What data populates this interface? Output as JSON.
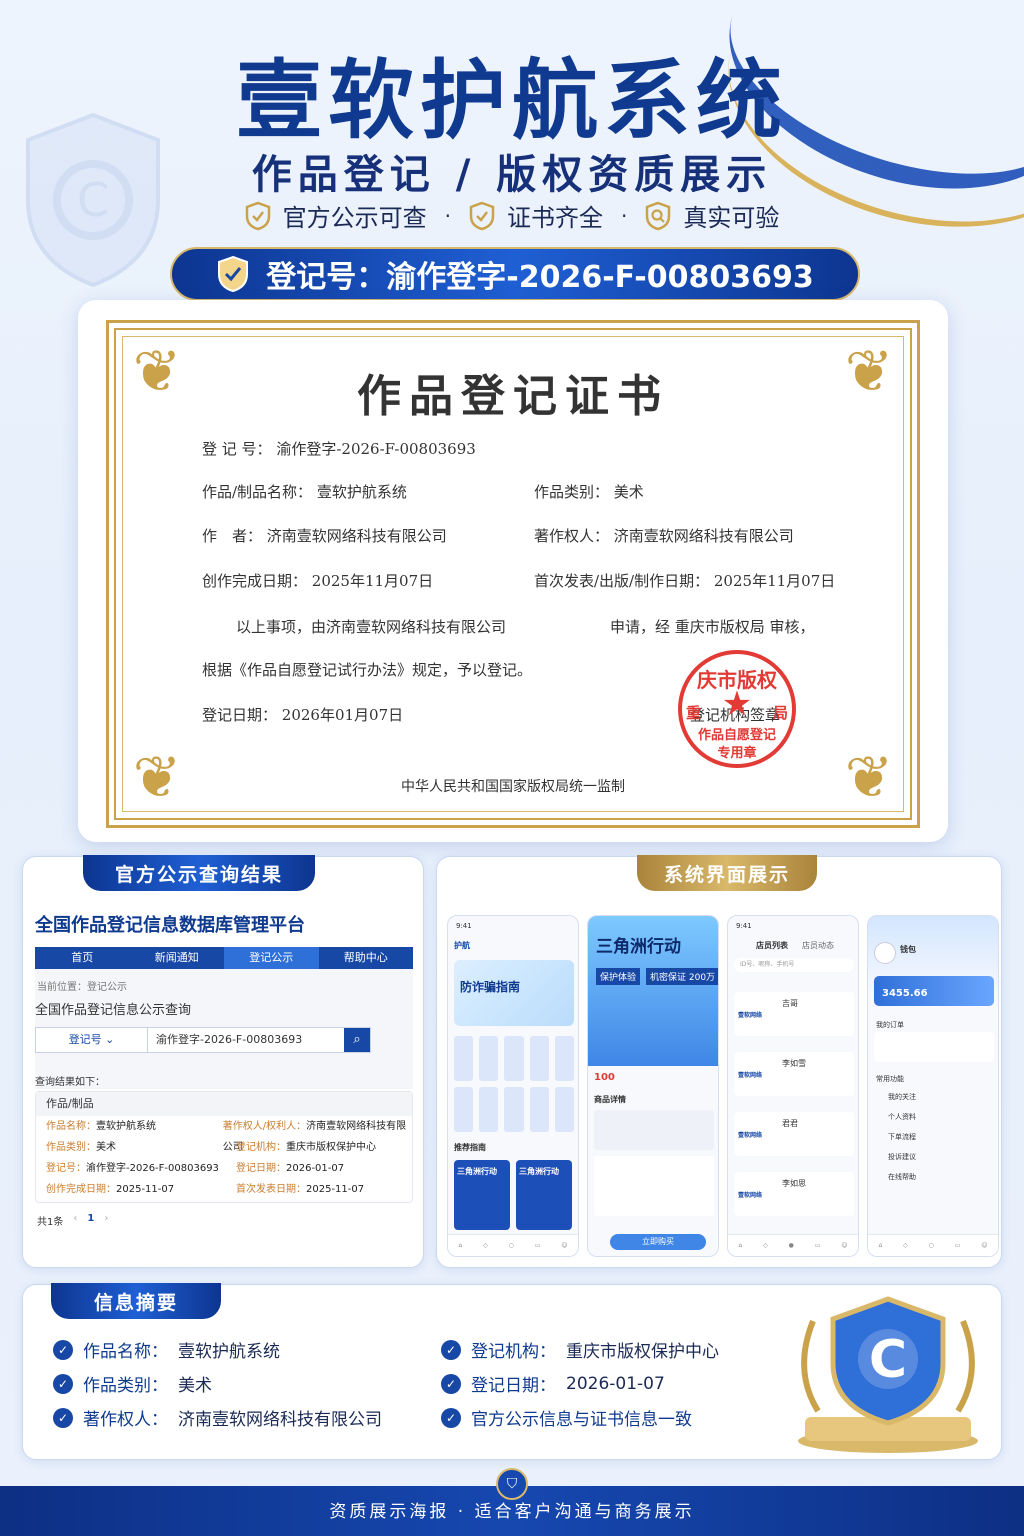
{
  "header": {
    "title": "壹软护航系统",
    "subtitle": "作品登记 / 版权资质展示",
    "badges": [
      "官方公示可查",
      "证书齐全",
      "真实可验"
    ],
    "reg_label": "登记号：渝作登字-2026-F-00803693"
  },
  "certificate": {
    "title": "作品登记证书",
    "reg_no_label": "登 记 号：",
    "reg_no": "渝作登字-2026-F-00803693",
    "work_name_label": "作品/制品名称：",
    "work_name": "壹软护航系统",
    "category_label": "作品类别：",
    "category": "美术",
    "author_label": "作　者：",
    "author": "济南壹软网络科技有限公司",
    "owner_label": "著作权人：",
    "owner": "济南壹软网络科技有限公司",
    "complete_label": "创作完成日期：",
    "complete_date": "2025年11月07日",
    "publish_label": "首次发表/出版/制作日期：",
    "publish_date": "2025年11月07日",
    "statement_1a": "以上事项，由济南壹软网络科技有限公司",
    "statement_1b": "申请，经 重庆市版权局 审核，",
    "statement_2": "根据《作品自愿登记试行办法》规定，予以登记。",
    "reg_date_label": "登记日期：",
    "reg_date": "2026年01月07日",
    "seal_under_text": "登记机构签章",
    "supervision": "中华人民共和国国家版权局统一监制",
    "seal": {
      "top": "庆市版权",
      "left": "重",
      "right": "局",
      "line1": "作品自愿登记",
      "line2": "专用章"
    }
  },
  "query_panel": {
    "tab": "官方公示查询结果",
    "platform": "全国作品登记信息数据库管理平台",
    "nav": [
      "首页",
      "新闻通知",
      "登记公示",
      "帮助中心"
    ],
    "location": "当前位置：登记公示",
    "search_title": "全国作品登记信息公示查询",
    "select_value": "登记号",
    "search_value": "渝作登字-2026-F-00803693",
    "result_label": "查询结果如下：",
    "table_head": "作品/制品",
    "rows": [
      {
        "k1": "作品名称：",
        "v1": "壹软护航系统",
        "k2": "著作权人/权利人：",
        "v2": "济南壹软网络科技有限公司"
      },
      {
        "k1": "作品类别：",
        "v1": "美术",
        "k2": "登记机构：",
        "v2": "重庆市版权保护中心"
      },
      {
        "k1": "登记号：",
        "v1": "渝作登字-2026-F-00803693",
        "k2": "登记日期：",
        "v2": "2026-01-07"
      },
      {
        "k1": "创作完成日期：",
        "v1": "2025-11-07",
        "k2": "首次发表日期：",
        "v2": "2025-11-07"
      }
    ],
    "pager_total": "共1条",
    "pager_page": "1"
  },
  "ui_panel": {
    "tab": "系统界面展示",
    "phone1": {
      "time": "9:41",
      "title": "护航",
      "banner": "防诈骗指南",
      "section": "推荐指南",
      "game": "三角洲行动"
    },
    "phone2": {
      "time": "",
      "banner": "三角洲行动",
      "tag1": "保护体验",
      "tag2": "机密保证 200万",
      "price": "100",
      "buy": "立即购买",
      "tab": "商品详情"
    },
    "phone3": {
      "time": "9:41",
      "tab1": "店员列表",
      "tab2": "店员动态",
      "search": "ID号、昵称、手机号",
      "names": [
        "吉哥",
        "李如雪",
        "君君",
        "李如思"
      ],
      "brand": "壹软网络"
    },
    "phone4": {
      "time": "9:41",
      "name": "钱包",
      "balance": "3455.66",
      "menu": [
        "我的订单",
        "常用功能",
        "我的关注",
        "个人资料",
        "下单流程",
        "投诉建议",
        "在线帮助"
      ]
    }
  },
  "summary": {
    "tab": "信息摘要",
    "items": [
      {
        "k": "作品名称：",
        "v": "壹软护航系统"
      },
      {
        "k": "作品类别：",
        "v": "美术"
      },
      {
        "k": "著作权人：",
        "v": "济南壹软网络科技有限公司"
      },
      {
        "k": "登记机构：",
        "v": "重庆市版权保护中心"
      },
      {
        "k": "登记日期：",
        "v": "2026-01-07"
      },
      {
        "k": "官方公示信息与证书信息一致",
        "v": ""
      }
    ],
    "emblem": "C"
  },
  "footer": {
    "text": "资质展示海报 · 适合客户沟通与商务展示"
  },
  "colors": {
    "primary": "#0f3a8f",
    "accent_blue": "#1f5fd4",
    "gold": "#c9a24a",
    "seal_red": "#e23a35"
  }
}
